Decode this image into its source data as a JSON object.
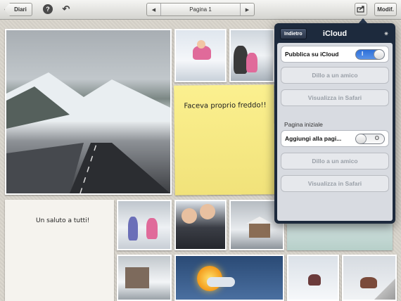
{
  "toolbar": {
    "back_label": "Diari",
    "help_icon": "help-icon",
    "undo_icon": "undo-icon",
    "page_label": "Pagina 1",
    "share_icon": "share-icon",
    "edit_label": "Modif."
  },
  "notes": {
    "yellow_text": "Faceva proprio freddo!!",
    "white_text": "Un saluto a tutti!"
  },
  "popover": {
    "back_label": "Indietro",
    "title": "iCloud",
    "spinner_icon": "spinner-icon",
    "publish_label": "Pubblica su iCloud",
    "publish_toggle": "I",
    "tell_friend_1": "Dillo a un amico",
    "view_safari_1": "Visualizza in Safari",
    "section_title": "Pagina iniziale",
    "add_home_label": "Aggiungi alla pagi...",
    "add_home_toggle": "O",
    "tell_friend_2": "Dillo a un amico",
    "view_safari_2": "Visualizza in Safari"
  }
}
